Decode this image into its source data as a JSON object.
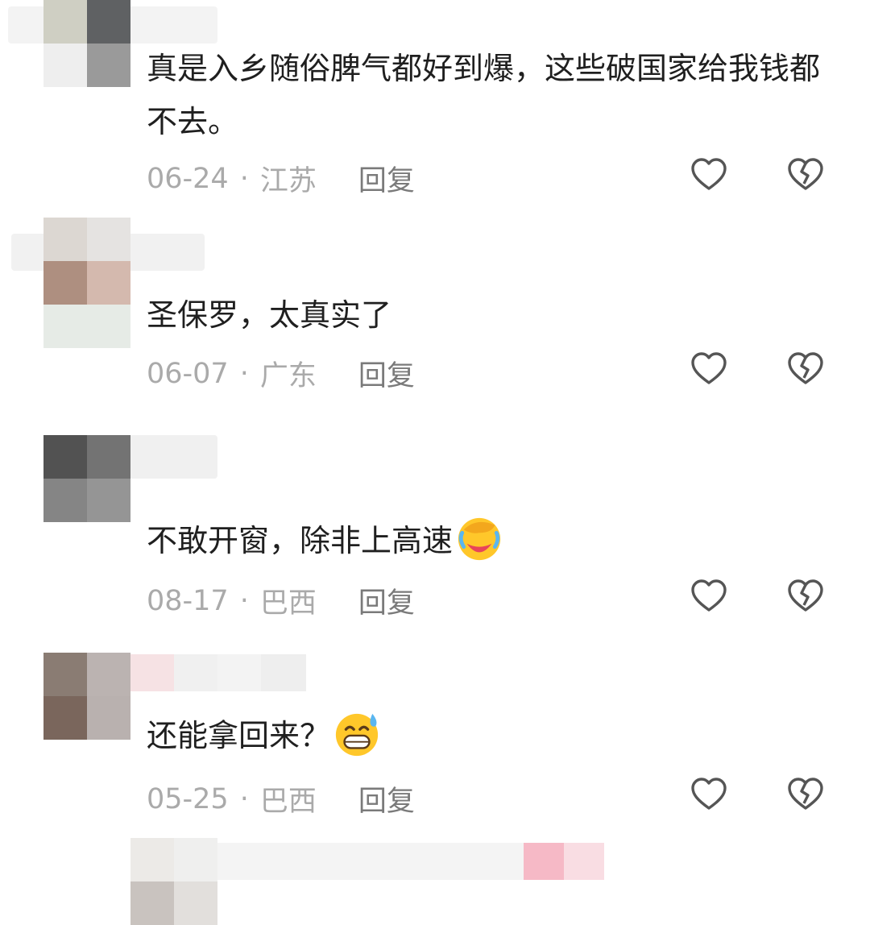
{
  "comments": [
    {
      "text": "真是入乡随俗脾气都好到爆，这些破国家给我钱都不去。",
      "date": "06-24",
      "sep": "·",
      "location": "江苏",
      "reply": "回复"
    },
    {
      "text": "圣保罗，太真实了",
      "date": "06-07",
      "sep": "·",
      "location": "广东",
      "reply": "回复"
    },
    {
      "text": "不敢开窗，除非上高速",
      "emoji": "face-palm-crying-emoji",
      "date": "08-17",
      "sep": "·",
      "location": "巴西",
      "reply": "回复"
    },
    {
      "text": "还能拿回来？",
      "emoji": "grinning-sweat-emoji",
      "date": "05-25",
      "sep": "·",
      "location": "巴西",
      "reply": "回复"
    }
  ],
  "icons": {
    "like": "heart-outline-icon",
    "dislike": "broken-heart-icon"
  },
  "colors": {
    "text": "#1f1f1f",
    "meta": "#aaaaaa",
    "reply": "#7a7a7a",
    "icon": "#555555"
  }
}
